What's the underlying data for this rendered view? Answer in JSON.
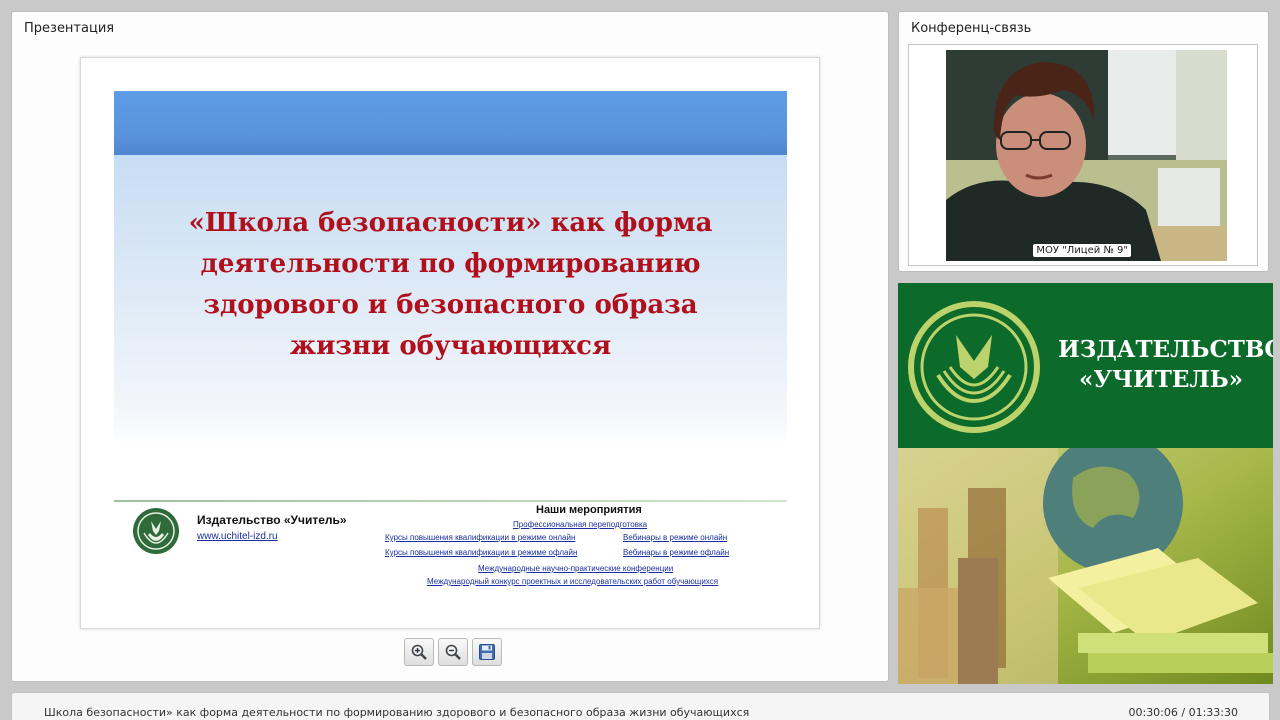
{
  "presentation_panel": {
    "title": "Презентация"
  },
  "slide": {
    "title": "«Школа безопасности» как форма деятельности по формированию здорового и безопасного образа жизни обучающихся",
    "publisher_name": "Издательство «Учитель»",
    "publisher_url": "www.uchitel-izd.ru",
    "events_heading": "Наши мероприятия",
    "events": {
      "prof_retraining": "Профессиональная переподготовка",
      "courses_online": "Курсы повышения квалификации в режиме онлайн",
      "webinars_online": "Вебинары в режиме онлайн",
      "courses_offline": "Курсы повышения квалификации в режиме офлайн",
      "webinars_offline": "Вебинары в режиме офлайн",
      "conferences": "Международные научно-практические конференции",
      "contest": "Международный конкурс проектных и исследовательских работ обучающихся"
    },
    "accent_color": "#b0101c",
    "header_color": "#5a93db"
  },
  "toolbar": {
    "zoom_in_icon": "zoom-in-icon",
    "zoom_out_icon": "zoom-out-icon",
    "save_icon": "floppy-save-icon"
  },
  "conference_panel": {
    "title": "Конференц-связь",
    "video_caption": "МОУ \"Лицей № 9\""
  },
  "ad_banner": {
    "line1": "ИЗДАТЕЛЬСТВО",
    "line2": "«УЧИТЕЛЬ»",
    "brand_color": "#0c6a2a"
  },
  "status_bar": {
    "title": "Школа безопасности» как форма деятельности по формированию здорового и безопасного образа жизни обучающихся",
    "time": "00:30:06 / 01:33:30"
  }
}
